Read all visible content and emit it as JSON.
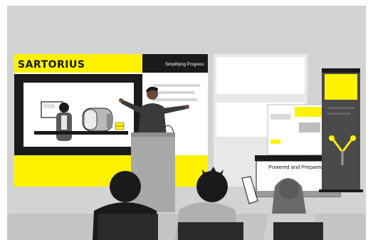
{
  "brand": {
    "logo": "SARTORIUS",
    "tagline": "Simplifying Progress"
  },
  "booth": {
    "caption": "Powered and Prepared"
  },
  "colors": {
    "accent_yellow": "#fff200",
    "dark": "#1a1a1a",
    "wall_gray": "#cfcfcf"
  }
}
